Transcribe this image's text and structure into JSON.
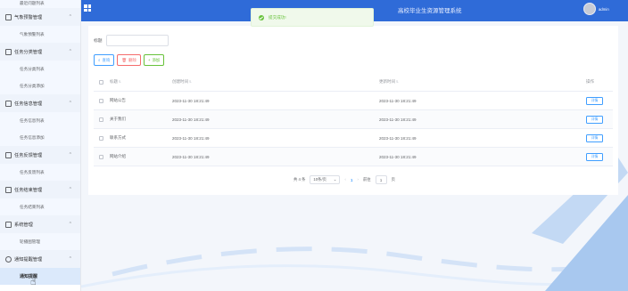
{
  "header": {
    "title": "高校毕业生资源管理系统",
    "username": "admin"
  },
  "toast": {
    "message": "提交成功!"
  },
  "sidebar": {
    "top_cut_label": "最近问题列表",
    "groups": [
      {
        "label": "气象预警管理",
        "items": [
          "气象预警列表"
        ]
      },
      {
        "label": "任务分类管理",
        "items": [
          "任务分类列表",
          "任务分类添加"
        ]
      },
      {
        "label": "任务信息管理",
        "items": [
          "任务信息列表",
          "任务信息添加"
        ]
      },
      {
        "label": "任务反馈管理",
        "items": [
          "任务反馈列表"
        ]
      },
      {
        "label": "任务结束管理",
        "items": [
          "任务结束列表"
        ]
      },
      {
        "label": "系统管理",
        "items": [
          "轮播图管理"
        ]
      },
      {
        "label": "通知提醒管理",
        "items": [
          "通知提醒"
        ]
      }
    ]
  },
  "filter": {
    "label": "标题",
    "placeholder": ""
  },
  "buttons": {
    "query": "查询",
    "delete": "删除",
    "add": "添加"
  },
  "table": {
    "columns": [
      "标题",
      "创建时间",
      "更新时间",
      "操作"
    ],
    "rows": [
      {
        "title": "网站公告",
        "created": "2023-11-30 18:21:49",
        "updated": "2023-11-30 18:21:49",
        "action": "详情"
      },
      {
        "title": "关于我们",
        "created": "2023-11-30 18:21:49",
        "updated": "2023-11-30 18:21:49",
        "action": "详情"
      },
      {
        "title": "联系方式",
        "created": "2023-11-30 18:21:49",
        "updated": "2023-11-30 18:21:49",
        "action": "详情"
      },
      {
        "title": "网站介绍",
        "created": "2023-11-30 18:21:49",
        "updated": "2023-11-30 18:21:49",
        "action": "详情"
      }
    ]
  },
  "pagination": {
    "total": "共 4 条",
    "page_size": "10条/页",
    "current_page": "1",
    "goto_label": "前往",
    "goto_value": "1",
    "page_suffix": "页"
  },
  "colors": {
    "header_bg": "#2f6bd8",
    "primary": "#409eff",
    "danger": "#f56c6c",
    "success": "#67c23a"
  },
  "icons": {
    "menu_toggle": "grid-icon",
    "query": "search-icon",
    "delete": "trash-icon",
    "add": "plus-icon",
    "toast": "check-circle-icon"
  }
}
